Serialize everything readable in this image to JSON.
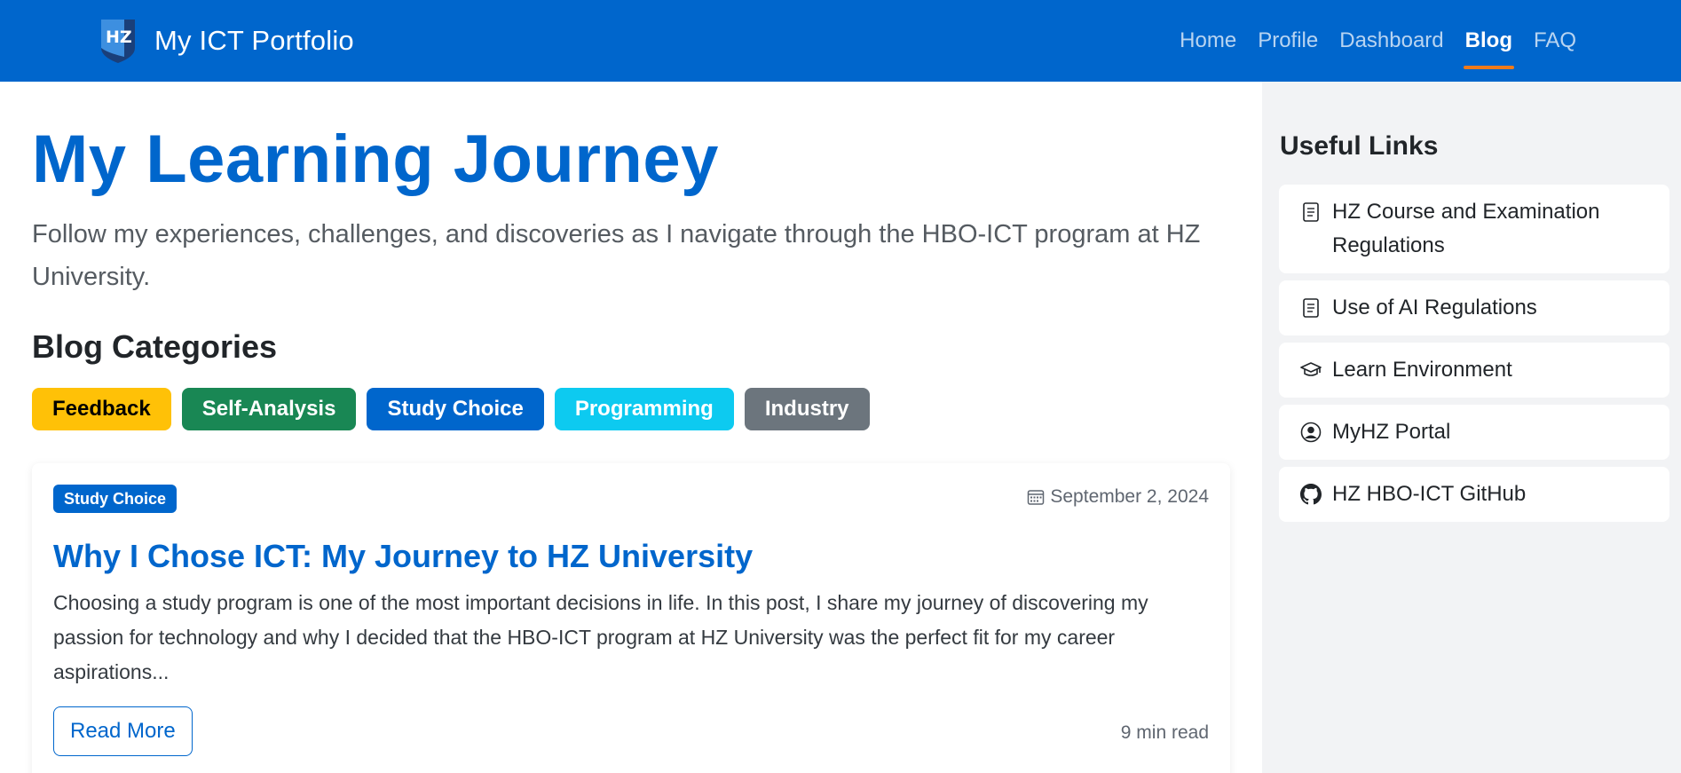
{
  "navbar": {
    "brand": "My ICT Portfolio",
    "logo_text": "HZ",
    "links": [
      {
        "label": "Home",
        "active": false
      },
      {
        "label": "Profile",
        "active": false
      },
      {
        "label": "Dashboard",
        "active": false
      },
      {
        "label": "Blog",
        "active": true
      },
      {
        "label": "FAQ",
        "active": false
      }
    ]
  },
  "main": {
    "title": "My Learning Journey",
    "lead": "Follow my experiences, challenges, and discoveries as I navigate through the HBO-ICT program at HZ University.",
    "categories_heading": "Blog Categories",
    "categories": [
      {
        "label": "Feedback",
        "color": "#ffc107",
        "text_color": "#000000"
      },
      {
        "label": "Self-Analysis",
        "color": "#198754",
        "text_color": "#ffffff"
      },
      {
        "label": "Study Choice",
        "color": "#0066cc",
        "text_color": "#ffffff"
      },
      {
        "label": "Programming",
        "color": "#0dcaf0",
        "text_color": "#ffffff"
      },
      {
        "label": "Industry",
        "color": "#6c757d",
        "text_color": "#ffffff"
      }
    ],
    "post": {
      "tag": "Study Choice",
      "date": "September 2, 2024",
      "title": "Why I Chose ICT: My Journey to HZ University",
      "excerpt": "Choosing a study program is one of the most important decisions in life. In this post, I share my journey of discovering my passion for technology and why I decided that the HBO-ICT program at HZ University was the perfect fit for my career aspirations...",
      "read_more": "Read More",
      "read_time": "9 min read"
    }
  },
  "sidebar": {
    "heading": "Useful Links",
    "links": [
      {
        "label": "HZ Course and Examination Regulations",
        "icon": "document-icon"
      },
      {
        "label": "Use of AI Regulations",
        "icon": "document-icon"
      },
      {
        "label": "Learn Environment",
        "icon": "graduation-cap-icon"
      },
      {
        "label": "MyHZ Portal",
        "icon": "person-circle-icon"
      },
      {
        "label": "HZ HBO-ICT GitHub",
        "icon": "github-icon"
      }
    ]
  },
  "colors": {
    "primary": "#0066cc",
    "nav_active_underline": "#f07b1a",
    "sidebar_bg": "#f2f3f5"
  }
}
